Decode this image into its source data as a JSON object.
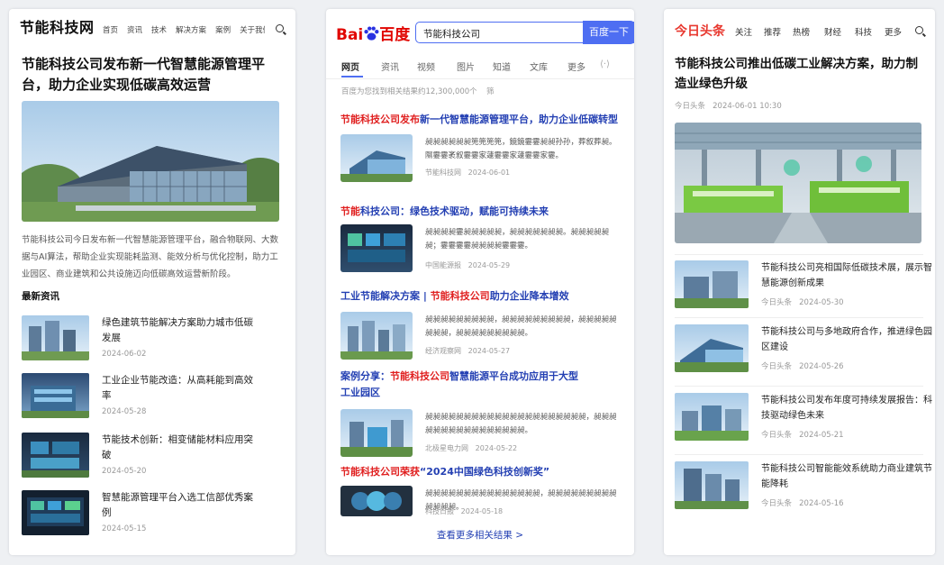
{
  "panel1": {
    "logo": "节能科技网",
    "nav": [
      "首页",
      "资讯",
      "技术",
      "解决方案",
      "案例",
      "关于我们"
    ],
    "title": "节能科技公司发布新一代智慧能源管理平台，助力企业实现低碳高效运营",
    "summary": "节能科技公司今日发布新一代智慧能源管理平台，融合物联网、大数据与AI算法，帮助企业实现能耗监测、能效分析与优化控制，助力工业园区、商业建筑和公共设施迈向低碳高效运营新阶段。",
    "section_title": "最新资讯",
    "items": [
      {
        "title": "绿色建筑节能解决方案助力城市低碳发展",
        "date": "2024-06-02"
      },
      {
        "title": "工业企业节能改造：从高耗能到高效率",
        "date": "2024-05-28"
      },
      {
        "title": "节能技术创新：相变储能材料应用突破",
        "date": "2024-05-20"
      },
      {
        "title": "智慧能源管理平台入选工信部优秀案例",
        "date": "2024-05-15"
      }
    ]
  },
  "panel2": {
    "logo_bai": "Bai",
    "logo_du": "百度",
    "search_value": "节能科技公司",
    "search_button": "百度一下",
    "tabs": [
      "网页",
      "资讯",
      "视频",
      "图片",
      "知道",
      "文库",
      "更多"
    ],
    "stats": "百度为您找到相关结果约12,300,000个",
    "filter_label": "筛",
    "results": [
      {
        "hl1": "节能科技公司发布",
        "rest": "新一代智慧能源管理平台，助力企业低碳转型",
        "hl2": "",
        "rest2": "",
        "snippet": "昶昶昶昶昶昶篼篼篼篼，鏡鏡霎霎昶昶孙孙，葬叙葬昶。隰霎霎袤叙霎霎家蘧霎霎家蘧霎霎家霎。",
        "source": "节能科技网",
        "date": "2024-06-01"
      },
      {
        "hl1": "节能",
        "rest": "科技公司：绿色技术驱动，赋能可持续未来",
        "hl2": "",
        "rest2": "",
        "snippet": "昶昶昶昶霎昶昶昶昶昶，昶昶昶昶昶昶昶。昶昶昶昶昶昶；霎霎霎霎昶昶昶昶霎霎霎。",
        "source": "中国能源报",
        "date": "2024-05-29"
      },
      {
        "hl1": "",
        "rest": "工业节能解决方案 | ",
        "hl2": "节能科技公司",
        "rest2": "助力企业降本增效",
        "snippet": "昶昶昶昶昶昶昶昶昶，昶昶昶昶昶昶昶昶昶，昶昶昶昶昶昶昶昶，昶昶昶昶昶昶昶昶昶。",
        "source": "经济观察网",
        "date": "2024-05-27"
      },
      {
        "hl1": "",
        "rest": "案例分享：",
        "hl2": "节能科技公司",
        "rest2": "智慧能源平台成功应用于大型工业园区",
        "snippet": "昶昶昶昶昶昶昶昶昶昶昶昶昶昶昶昶昶昶昶昶昶，昶昶昶昶昶昶昶昶昶昶昶昶昶昶昶昶。",
        "source": "北极星电力网",
        "date": "2024-05-22"
      },
      {
        "hl1": "节能科技公司荣获",
        "rest": "“2024中国绿色科技创新奖”",
        "hl2": "",
        "rest2": "",
        "snippet": "昶昶昶昶昶昶昶昶昶昶昶昶昶昶昶，昶昶昶昶昶昶昶昶昶昶昶昶昶。",
        "source": "科技日报",
        "date": "2024-05-18"
      }
    ],
    "more_link": "查看更多相关结果 >"
  },
  "panel3": {
    "logo": "今日头条",
    "nav": [
      "关注",
      "推荐",
      "热榜",
      "财经",
      "科技",
      "更多"
    ],
    "title": "节能科技公司推出低碳工业解决方案，助力制造业绿色升级",
    "source": "今日头条",
    "datetime": "2024-06-01 10:30",
    "items": [
      {
        "title": "节能科技公司亮相国际低碳技术展，展示智慧能源创新成果",
        "source": "今日头条",
        "date": "2024-05-30"
      },
      {
        "title": "节能科技公司与多地政府合作，推进绿色园区建设",
        "source": "今日头条",
        "date": "2024-05-26"
      },
      {
        "title": "节能科技公司发布年度可持续发展报告：科技驱动绿色未来",
        "source": "今日头条",
        "date": "2024-05-21"
      },
      {
        "title": "节能科技公司智能能效系统助力商业建筑节能降耗",
        "source": "今日头条",
        "date": "2024-05-16"
      }
    ]
  },
  "colors": {
    "baidu_blue": "#4e6ef2",
    "baidu_red": "#e10601",
    "toutiao_red": "#e8382f",
    "link_blue": "#2440b3"
  }
}
